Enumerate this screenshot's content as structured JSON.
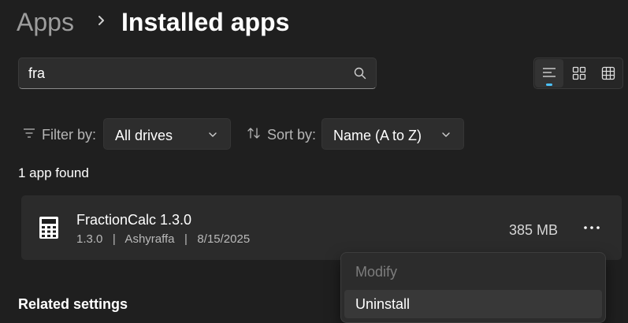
{
  "breadcrumb": {
    "parent": "Apps",
    "current": "Installed apps"
  },
  "search": {
    "value": "fra",
    "icon": "search-icon"
  },
  "view_modes": [
    {
      "name": "list",
      "icon": "list-view-icon",
      "active": true
    },
    {
      "name": "tiles",
      "icon": "tile-view-icon",
      "active": false
    },
    {
      "name": "grid",
      "icon": "grid-view-icon",
      "active": false
    }
  ],
  "filter": {
    "label": "Filter by:",
    "value": "All drives"
  },
  "sort": {
    "label": "Sort by:",
    "value": "Name (A to Z)"
  },
  "result_count": "1 app found",
  "apps": [
    {
      "name": "FractionCalc 1.3.0",
      "meta": "1.3.0   |   Ashyraffa   |   8/15/2025",
      "size": "385 MB",
      "icon": "calculator-icon"
    }
  ],
  "context_menu": {
    "modify": "Modify",
    "uninstall": "Uninstall",
    "modify_enabled": false
  },
  "related_settings": "Related settings",
  "colors": {
    "background": "#1f1f1f",
    "surface": "#2b2b2b",
    "accent": "#4cc2ff",
    "text_secondary": "#b9b9b9"
  }
}
